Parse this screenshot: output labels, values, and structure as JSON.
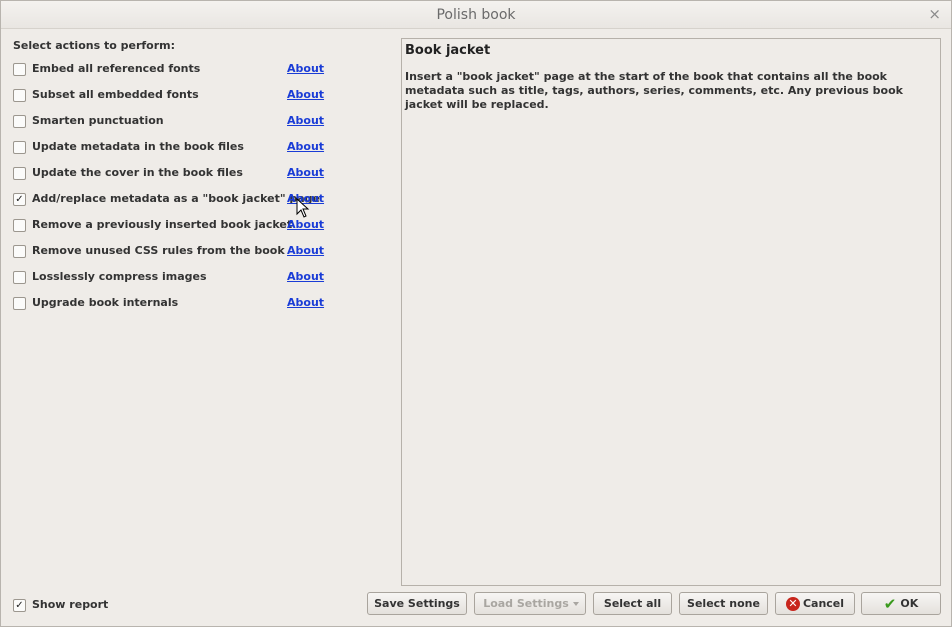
{
  "window": {
    "title": "Polish book",
    "close_glyph": "×"
  },
  "actions_label": "Select actions to perform:",
  "actions": [
    {
      "label": "Embed all referenced fonts",
      "checked": false,
      "about": "About"
    },
    {
      "label": "Subset all embedded fonts",
      "checked": false,
      "about": "About"
    },
    {
      "label": "Smarten punctuation",
      "checked": false,
      "about": "About"
    },
    {
      "label": "Update metadata in the book files",
      "checked": false,
      "about": "About"
    },
    {
      "label": "Update the cover in the book files",
      "checked": false,
      "about": "About"
    },
    {
      "label": "Add/replace metadata as a \"book jacket\" page",
      "checked": true,
      "about": "About"
    },
    {
      "label": "Remove a previously inserted book jacket",
      "checked": false,
      "about": "About"
    },
    {
      "label": "Remove unused CSS rules from the book",
      "checked": false,
      "about": "About"
    },
    {
      "label": "Losslessly compress images",
      "checked": false,
      "about": "About"
    },
    {
      "label": "Upgrade book internals",
      "checked": false,
      "about": "About"
    }
  ],
  "description": {
    "title": "Book jacket",
    "text": "Insert a \"book jacket\" page at the start of the book that contains all the book metadata such as title, tags, authors, series, comments, etc. Any previous book jacket will be replaced."
  },
  "show_report": {
    "label": "Show report",
    "checked": true
  },
  "buttons": {
    "save_settings": "Save Settings",
    "load_settings": "Load Settings",
    "select_all": "Select all",
    "select_none": "Select none",
    "cancel": "Cancel",
    "ok": "OK"
  },
  "check_glyph": "✓"
}
